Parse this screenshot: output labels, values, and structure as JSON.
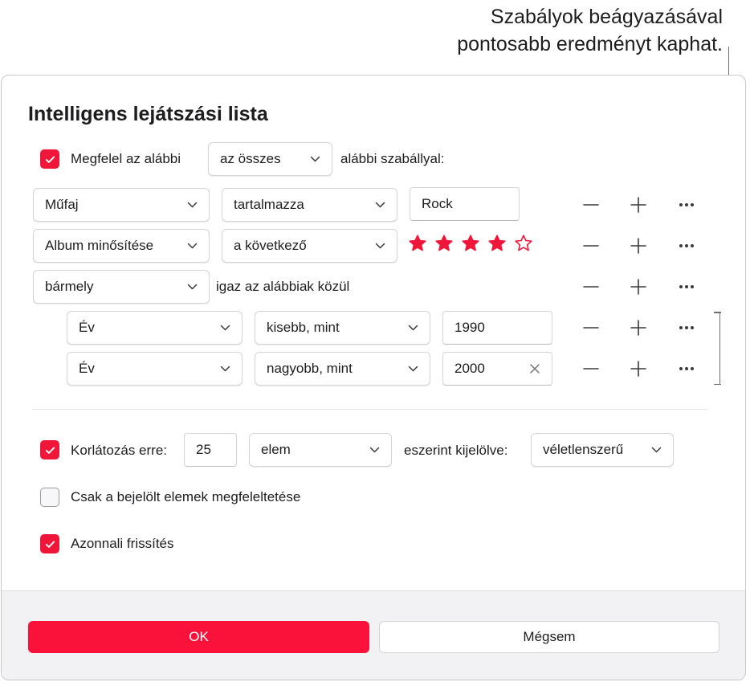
{
  "callout": {
    "line1": "Szabályok beágyazásával",
    "line2": "pontosabb eredményt kaphat."
  },
  "dialog": {
    "title": "Intelligens lejátszási lista",
    "match": {
      "prefix": "Megfelel az alábbi",
      "selector": "az összes",
      "suffix": "alábbi szabállyal:",
      "checked": true
    },
    "rules": [
      {
        "field": "Műfaj",
        "operator": "tartalmazza",
        "value": "Rock"
      },
      {
        "field": "Album minősítése",
        "operator": "a következő",
        "rating": 4,
        "max_rating": 5
      },
      {
        "field": "bármely",
        "operator_text": "igaz az alábbiak közül"
      }
    ],
    "nested_rules": [
      {
        "field": "Év",
        "operator": "kisebb, mint",
        "value": "1990"
      },
      {
        "field": "Év",
        "operator": "nagyobb, mint",
        "value": "2000"
      }
    ],
    "limit": {
      "label": "Korlátozás erre:",
      "value": "25",
      "unit": "elem",
      "selected_by_label": "eszerint kijelölve:",
      "selected_by": "véletlenszerű",
      "checked": true
    },
    "checked_only": {
      "label": "Csak a bejelölt elemek megfeleltetése",
      "checked": false
    },
    "live_update": {
      "label": "Azonnali frissítés",
      "checked": true
    },
    "buttons": {
      "ok": "OK",
      "cancel": "Mégsem"
    }
  },
  "colors": {
    "accent": "#f0163a",
    "ok_button": "#fa123b"
  },
  "icons": [
    "minus-icon",
    "plus-icon",
    "more-icon",
    "chevron-down-icon",
    "star-icon",
    "checkmark-icon",
    "clear-icon"
  ]
}
